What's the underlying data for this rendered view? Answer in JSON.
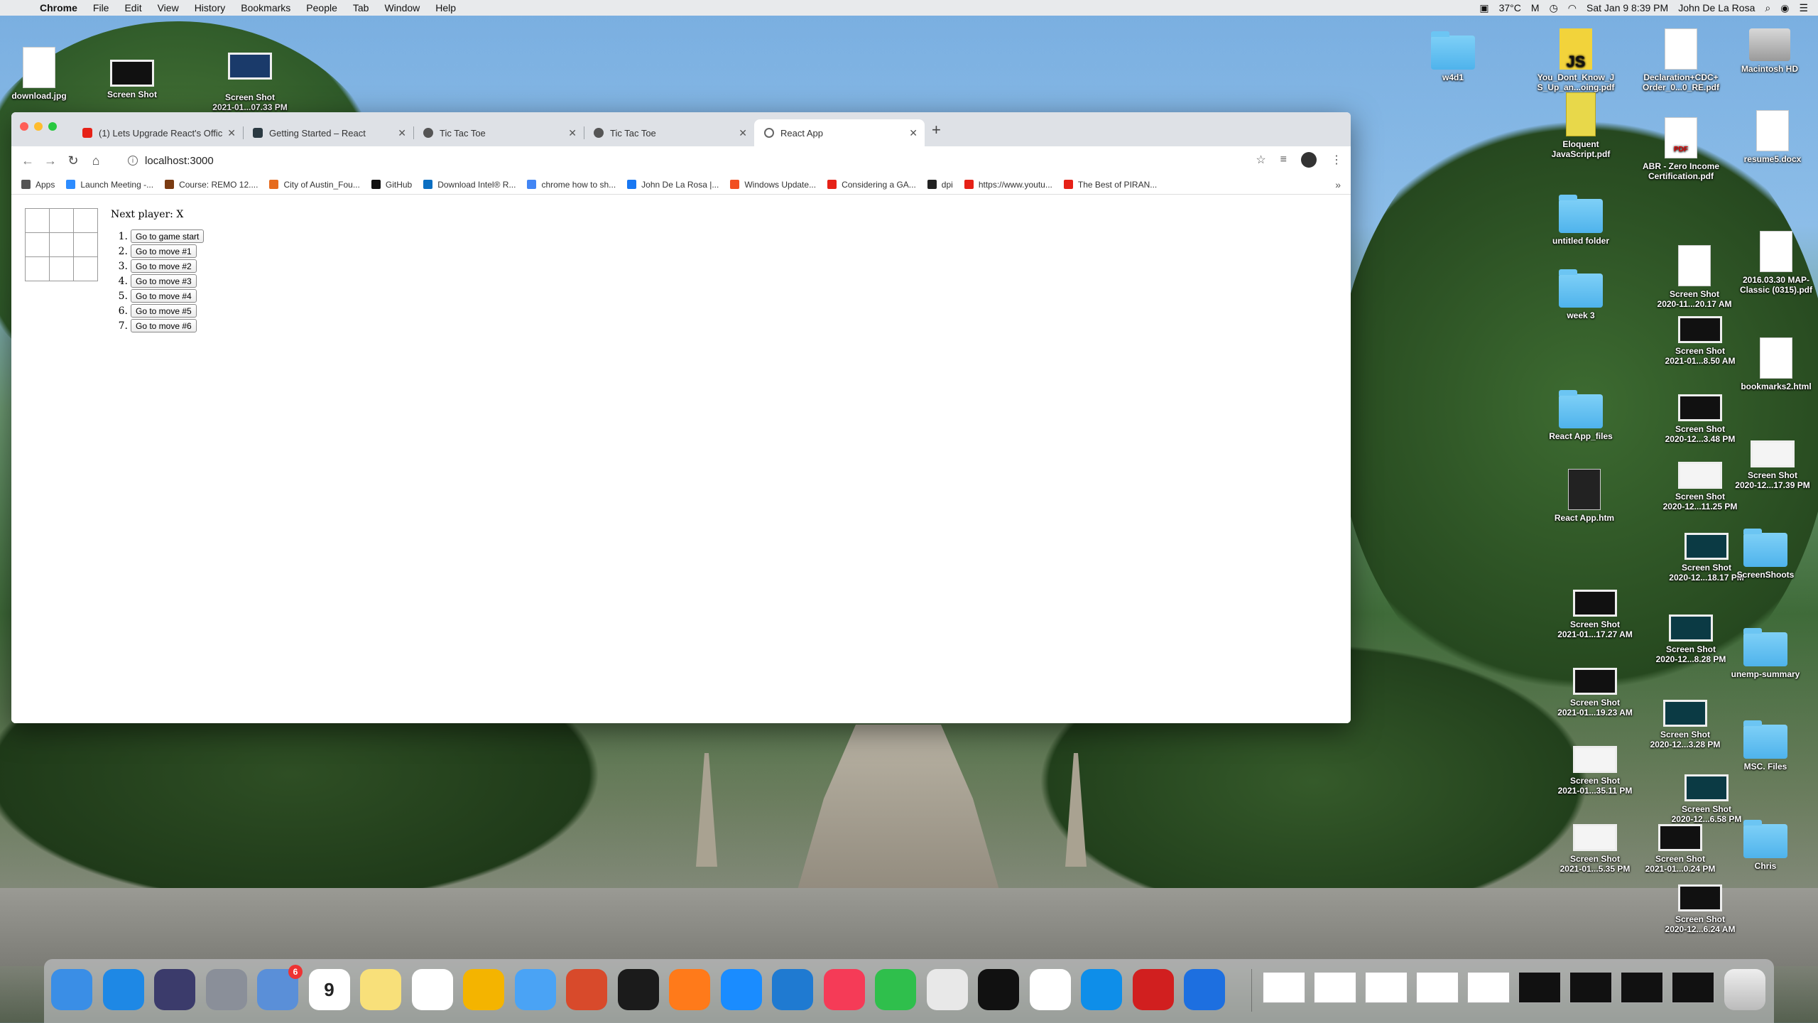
{
  "menubar": {
    "app": "Chrome",
    "items": [
      "File",
      "Edit",
      "View",
      "History",
      "Bookmarks",
      "People",
      "Tab",
      "Window",
      "Help"
    ],
    "temperature": "37°C",
    "datetime": "Sat Jan 9  8:39 PM",
    "user": "John De La Rosa"
  },
  "desktop": {
    "left_icons": [
      {
        "label": "download.jpg"
      },
      {
        "label": "Screen Shot"
      },
      {
        "label": "Screen Shot\n2021-01...07.33 PM"
      }
    ],
    "right_icons": [
      {
        "label": "w4d1"
      },
      {
        "label": "You_Dont_Know_J\nS_Up_an...oing.pdf"
      },
      {
        "label": "Declaration+CDC+\nOrder_0...0_RE.pdf"
      },
      {
        "label": "Macintosh HD"
      },
      {
        "label": "Eloquent\nJavaScript.pdf"
      },
      {
        "label": "ABR - Zero Income\nCertification.pdf"
      },
      {
        "label": "resume5.docx"
      },
      {
        "label": "untitled folder"
      },
      {
        "label": "Screen Shot\n2020-11...20.17 AM"
      },
      {
        "label": "2016.03.30 MAP-\nClassic (0315).pdf"
      },
      {
        "label": "week 3"
      },
      {
        "label": "Screen Shot\n2021-01...8.50 AM"
      },
      {
        "label": "bookmarks2.html"
      },
      {
        "label": "React App_files"
      },
      {
        "label": "Screen Shot\n2020-12...3.48 PM"
      },
      {
        "label": "Screen Shot\n2020-12...17.39 PM"
      },
      {
        "label": "React App.htm"
      },
      {
        "label": "Screen Shot\n2020-12...11.25 PM"
      },
      {
        "label": "Screen Shot\n2020-12...18.17 PM"
      },
      {
        "label": "ScreenShoots"
      },
      {
        "label": "Screen Shot\n2021-01...17.27 AM"
      },
      {
        "label": "Screen Shot\n2020-12...8.28 PM"
      },
      {
        "label": "unemp-summary"
      },
      {
        "label": "Screen Shot\n2021-01...19.23 AM"
      },
      {
        "label": "Screen Shot\n2020-12...3.28 PM"
      },
      {
        "label": "MSC. Files"
      },
      {
        "label": "Screen Shot\n2021-01...35.11 PM"
      },
      {
        "label": "Screen Shot\n2020-12...6.58 PM"
      },
      {
        "label": "Screen Shot\n2021-01...5.35 PM"
      },
      {
        "label": "Screen Shot\n2021-01...0.24 PM"
      },
      {
        "label": "Chris"
      },
      {
        "label": "Screen Shot\n2020-12...6.24 AM"
      }
    ]
  },
  "browser": {
    "tabs": [
      {
        "title": "(1) Lets Upgrade React's Offic",
        "color": "#e62117"
      },
      {
        "title": "Getting Started – React",
        "color": "#2b3a42"
      },
      {
        "title": "Tic Tac Toe",
        "color": "#555555"
      },
      {
        "title": "Tic Tac Toe",
        "color": "#555555"
      },
      {
        "title": "React App",
        "color": "#666666"
      }
    ],
    "address": "localhost:3000",
    "bookmarks": [
      {
        "label": "Apps",
        "color": "#555555"
      },
      {
        "label": "Launch Meeting -...",
        "color": "#2d8cff"
      },
      {
        "label": "Course: REMO 12....",
        "color": "#7a3b12"
      },
      {
        "label": "City of Austin_Fou...",
        "color": "#e66b1e"
      },
      {
        "label": "GitHub",
        "color": "#111111"
      },
      {
        "label": "Download Intel® R...",
        "color": "#0b6fc2"
      },
      {
        "label": "chrome how to sh...",
        "color": "#4285f4"
      },
      {
        "label": "John De La Rosa |...",
        "color": "#1877f2"
      },
      {
        "label": "Windows Update...",
        "color": "#f25022"
      },
      {
        "label": "Considering a GA...",
        "color": "#e62117"
      },
      {
        "label": "dpi",
        "color": "#222222"
      },
      {
        "label": "https://www.youtu...",
        "color": "#e62117"
      },
      {
        "label": "The Best of PIRAN...",
        "color": "#e62117"
      }
    ]
  },
  "game": {
    "status": "Next player: X",
    "moves": [
      {
        "num": "1.",
        "label": "Go to game start"
      },
      {
        "num": "2.",
        "label": "Go to move #1"
      },
      {
        "num": "3.",
        "label": "Go to move #2"
      },
      {
        "num": "4.",
        "label": "Go to move #3"
      },
      {
        "num": "5.",
        "label": "Go to move #4"
      },
      {
        "num": "6.",
        "label": "Go to move #5"
      },
      {
        "num": "7.",
        "label": "Go to move #6"
      }
    ]
  },
  "dock": {
    "apps": [
      {
        "icon": "finder-icon",
        "color": "#3a8ee6"
      },
      {
        "icon": "safari-icon",
        "color": "#1e88e5"
      },
      {
        "icon": "siri-icon",
        "color": "#3b3b6b"
      },
      {
        "icon": "launchpad-icon",
        "color": "#8a8f99"
      },
      {
        "icon": "mail-icon",
        "color": "#5a8fd8",
        "badge": "6"
      },
      {
        "icon": "calendar-icon",
        "color": "#ffffff",
        "text": "9"
      },
      {
        "icon": "notes-icon",
        "color": "#f8e07a"
      },
      {
        "icon": "reminders-icon",
        "color": "#ffffff"
      },
      {
        "icon": "photos-icon",
        "color": "#f4b400"
      },
      {
        "icon": "messages-icon",
        "color": "#4aa3f5"
      },
      {
        "icon": "remote-desktop-icon",
        "color": "#d84a2b"
      },
      {
        "icon": "terminal-icon",
        "color": "#1b1b1b"
      },
      {
        "icon": "firefox-icon",
        "color": "#ff7a1a"
      },
      {
        "icon": "app-store-icon",
        "color": "#1a8cff"
      },
      {
        "icon": "vscode-icon",
        "color": "#1f7ad1"
      },
      {
        "icon": "music-icon",
        "color": "#f53b57"
      },
      {
        "icon": "facetime-icon",
        "color": "#2fbf4c"
      },
      {
        "icon": "chrome-icon",
        "color": "#e8e8e8"
      },
      {
        "icon": "pycharm-icon",
        "color": "#111111"
      },
      {
        "icon": "slack-icon",
        "color": "#ffffff"
      },
      {
        "icon": "teamviewer-icon",
        "color": "#0e8ee9"
      },
      {
        "icon": "acrobat-icon",
        "color": "#d11f1f"
      },
      {
        "icon": "airline-icon",
        "color": "#1d6fe0"
      }
    ]
  }
}
